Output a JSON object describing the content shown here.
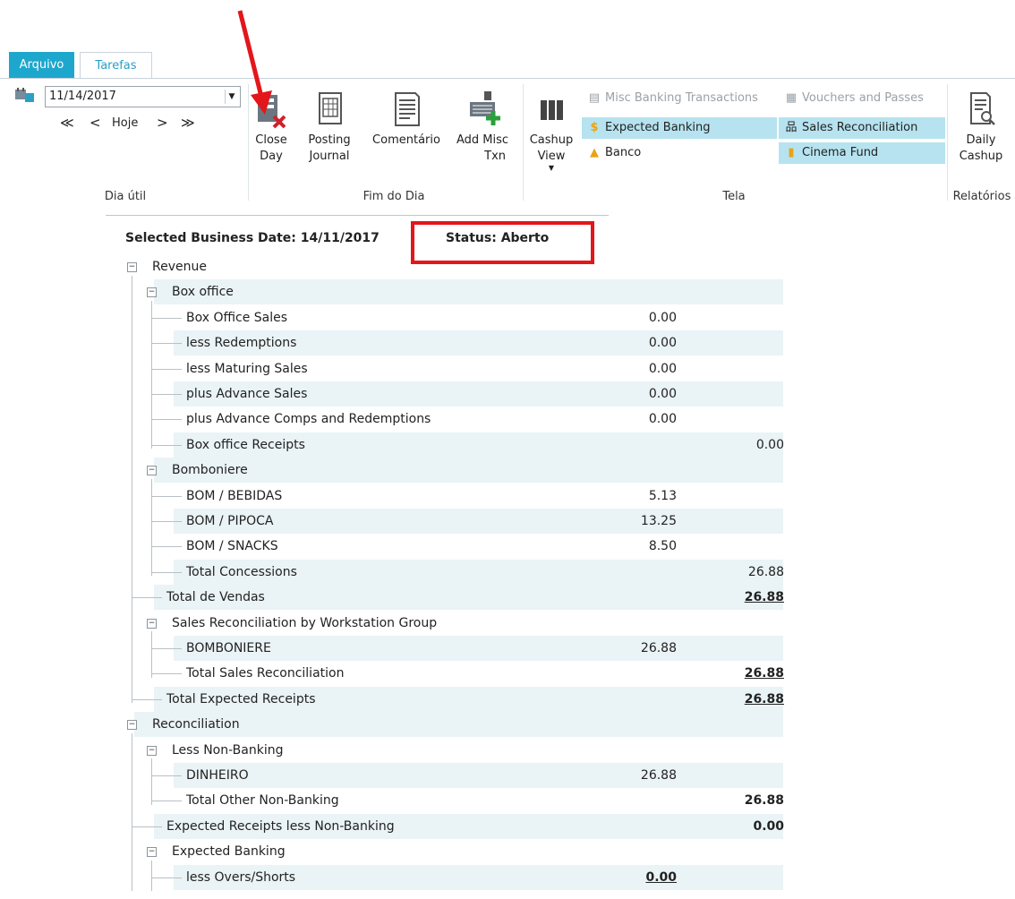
{
  "tabs": {
    "file": "Arquivo",
    "tasks": "Tarefas"
  },
  "date_group": {
    "date_value": "11/14/2017",
    "nav": [
      "≪",
      "<",
      "Hoje",
      ">",
      "≫"
    ],
    "title": "Dia útil"
  },
  "end_of_day": {
    "title": "Fim do Dia",
    "close_day": [
      "Close",
      "Day"
    ],
    "posting_journal": [
      "Posting",
      "Journal"
    ],
    "comment": "Comentário",
    "add_misc": [
      "Add Misc",
      "Txn"
    ]
  },
  "tela": {
    "title": "Tela",
    "cashup_view": [
      "Cashup",
      "View"
    ],
    "misc_banking": "Misc Banking Transactions",
    "vouchers": "Vouchers and Passes",
    "expected_banking": "Expected Banking",
    "sales_reconciliation": "Sales Reconciliation",
    "banco": "Banco",
    "cinema_fund": "Cinema Fund"
  },
  "reports": {
    "title": "Relatórios",
    "daily_cashup": [
      "Daily",
      "Cashup"
    ]
  },
  "header": {
    "selected_date": "Selected Business Date: 14/11/2017",
    "status": "Status: Aberto"
  },
  "rows": [
    {
      "label": "Revenue",
      "v1": "",
      "v2": ""
    },
    {
      "label": "Box office",
      "v1": "",
      "v2": ""
    },
    {
      "label": "Box Office Sales",
      "v1": "0.00",
      "v2": ""
    },
    {
      "label": "less Redemptions",
      "v1": "0.00",
      "v2": ""
    },
    {
      "label": "less Maturing Sales",
      "v1": "0.00",
      "v2": ""
    },
    {
      "label": "plus Advance Sales",
      "v1": "0.00",
      "v2": ""
    },
    {
      "label": "plus Advance Comps and Redemptions",
      "v1": "0.00",
      "v2": ""
    },
    {
      "label": "Box office Receipts",
      "v1": "",
      "v2": "0.00"
    },
    {
      "label": "Bomboniere",
      "v1": "",
      "v2": ""
    },
    {
      "label": "BOM / BEBIDAS",
      "v1": "5.13",
      "v2": ""
    },
    {
      "label": "BOM / PIPOCA",
      "v1": "13.25",
      "v2": ""
    },
    {
      "label": "BOM / SNACKS",
      "v1": "8.50",
      "v2": ""
    },
    {
      "label": "Total Concessions",
      "v1": "",
      "v2": "26.88"
    },
    {
      "label": "Total de Vendas",
      "v1": "",
      "v2": "26.88"
    },
    {
      "label": "Sales Reconciliation by Workstation Group",
      "v1": "",
      "v2": ""
    },
    {
      "label": "BOMBONIERE",
      "v1": "26.88",
      "v2": ""
    },
    {
      "label": "Total Sales Reconciliation",
      "v1": "",
      "v2": "26.88"
    },
    {
      "label": "Total Expected Receipts",
      "v1": "",
      "v2": "26.88"
    },
    {
      "label": "Reconciliation",
      "v1": "",
      "v2": ""
    },
    {
      "label": "Less Non-Banking",
      "v1": "",
      "v2": ""
    },
    {
      "label": "DINHEIRO",
      "v1": "26.88",
      "v2": ""
    },
    {
      "label": "Total Other Non-Banking",
      "v1": "",
      "v2": "26.88"
    },
    {
      "label": "Expected Receipts less Non-Banking",
      "v1": "",
      "v2": "0.00"
    },
    {
      "label": "Expected Banking",
      "v1": "",
      "v2": ""
    },
    {
      "label": "less Overs/Shorts",
      "v1": "0.00",
      "v2": ""
    }
  ],
  "colors": {
    "accent": "#1ea7cd",
    "highlight": "#b6e3ef",
    "annotation": "#e3161b",
    "row_shade": "#eaf3f5"
  }
}
